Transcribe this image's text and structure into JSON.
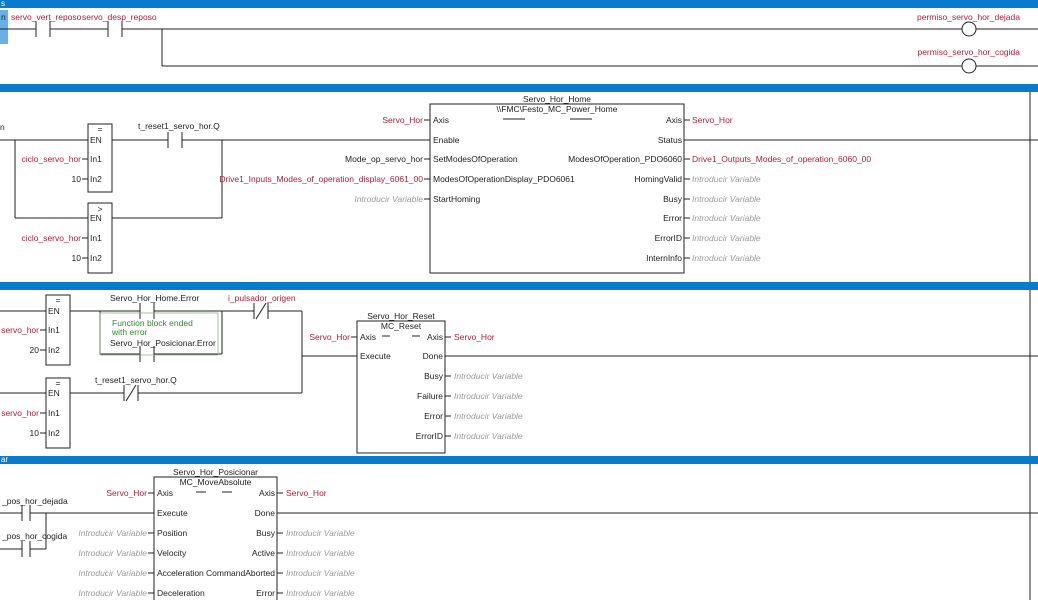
{
  "placeholder": "Introducir Variable",
  "rungs": [
    {
      "id": "r1",
      "band_label": "s",
      "contacts": [
        "servo_vert_reposo",
        "servo_desp_reposo"
      ],
      "left_partial": "n",
      "coils": [
        "permiso_servo_hor_dejada",
        "permiso_servo_hor_cogida"
      ]
    },
    {
      "id": "r2",
      "left_partial": "n",
      "cmp1": {
        "op": "=",
        "en": "EN",
        "in1_label": "In1",
        "in2_label": "In2",
        "in1": "ciclo_servo_hor",
        "in2": "10"
      },
      "cmp2": {
        "op": ">",
        "en": "EN",
        "in1_label": "In1",
        "in2_label": "In2",
        "in1": "ciclo_servo_hor",
        "in2": "10"
      },
      "contact": "t_reset1_servo_hor.Q",
      "fb": {
        "instance": "Servo_Hor_Home",
        "type": "\\\\FMC\\Festo_MC_Power_Home",
        "inputs": [
          {
            "pin": "Axis",
            "var": "Servo_Hor"
          },
          {
            "pin": "Enable",
            "var": ""
          },
          {
            "pin": "SetModesOfOperation",
            "var": "Mode_op_servo_hor"
          },
          {
            "pin": "ModesOfOperationDisplay_PDO6061",
            "var": "Drive1_Inputs_Modes_of_operation_display_6061_00"
          },
          {
            "pin": "StartHoming",
            "var": "Introducir Variable"
          }
        ],
        "outputs": [
          {
            "pin": "Axis",
            "var": "Servo_Hor"
          },
          {
            "pin": "Status",
            "var": ""
          },
          {
            "pin": "ModesOfOperation_PDO6060",
            "var": "Drive1_Outputs_Modes_of_operation_6060_00"
          },
          {
            "pin": "HomingValid",
            "var": "Introducir Variable"
          },
          {
            "pin": "Busy",
            "var": "Introducir Variable"
          },
          {
            "pin": "Error",
            "var": "Introducir Variable"
          },
          {
            "pin": "ErrorID",
            "var": "Introducir Variable"
          },
          {
            "pin": "InternInfo",
            "var": "Introducir Variable"
          }
        ]
      }
    },
    {
      "id": "r3",
      "cmp1": {
        "op": "=",
        "en": "EN",
        "in1_label": "In1",
        "in2_label": "In2",
        "in1": "servo_hor",
        "in2": "20"
      },
      "cmp2": {
        "op": "=",
        "en": "EN",
        "in1_label": "In1",
        "in2_label": "In2",
        "in1": "servo_hor",
        "in2": "10"
      },
      "contact_a": "Servo_Hor_Home.Error",
      "annotation": [
        "Function block ended",
        "with error"
      ],
      "contact_b": "Servo_Hor_Posicionar.Error",
      "contact_c": "t_reset1_servo_hor.Q",
      "contact_d": "i_pulsador_origen",
      "fb": {
        "instance": "Servo_Hor_Reset",
        "type": "MC_Reset",
        "inputs": [
          {
            "pin": "Axis",
            "var": "Servo_Hor"
          },
          {
            "pin": "Execute",
            "var": ""
          }
        ],
        "outputs": [
          {
            "pin": "Axis",
            "var": "Servo_Hor"
          },
          {
            "pin": "Done",
            "var": ""
          },
          {
            "pin": "Busy",
            "var": "Introducir Variable"
          },
          {
            "pin": "Failure",
            "var": "Introducir Variable"
          },
          {
            "pin": "Error",
            "var": "Introducir Variable"
          },
          {
            "pin": "ErrorID",
            "var": "Introducir Variable"
          }
        ]
      }
    },
    {
      "id": "r4",
      "band_label": "ar",
      "contacts": [
        "_pos_hor_dejada",
        "_pos_hor_cogida"
      ],
      "fb": {
        "instance": "Servo_Hor_Posicionar",
        "type": "MC_MoveAbsolute",
        "inputs": [
          {
            "pin": "Axis",
            "var": "Servo_Hor"
          },
          {
            "pin": "Execute",
            "var": ""
          },
          {
            "pin": "Position",
            "var": "Introducir Variable"
          },
          {
            "pin": "Velocity",
            "var": "Introducir Variable"
          },
          {
            "pin": "Acceleration",
            "var": "Introducir Variable"
          },
          {
            "pin": "Deceleration",
            "var": "Introducir Variable"
          }
        ],
        "outputs": [
          {
            "pin": "Axis",
            "var": "Servo_Hor"
          },
          {
            "pin": "Done",
            "var": ""
          },
          {
            "pin": "Busy",
            "var": "Introducir Variable"
          },
          {
            "pin": "Active",
            "var": "Introducir Variable"
          },
          {
            "pin": "CommandAborted",
            "var": "Introducir Variable"
          },
          {
            "pin": "Error",
            "var": "Introducir Variable"
          }
        ]
      }
    }
  ],
  "colors": {
    "band": "#0a7bcc",
    "variable": "#b01c36",
    "placeholder": "#9a9a9a",
    "wire": "#222222",
    "annotation": "#2e8b2e"
  }
}
